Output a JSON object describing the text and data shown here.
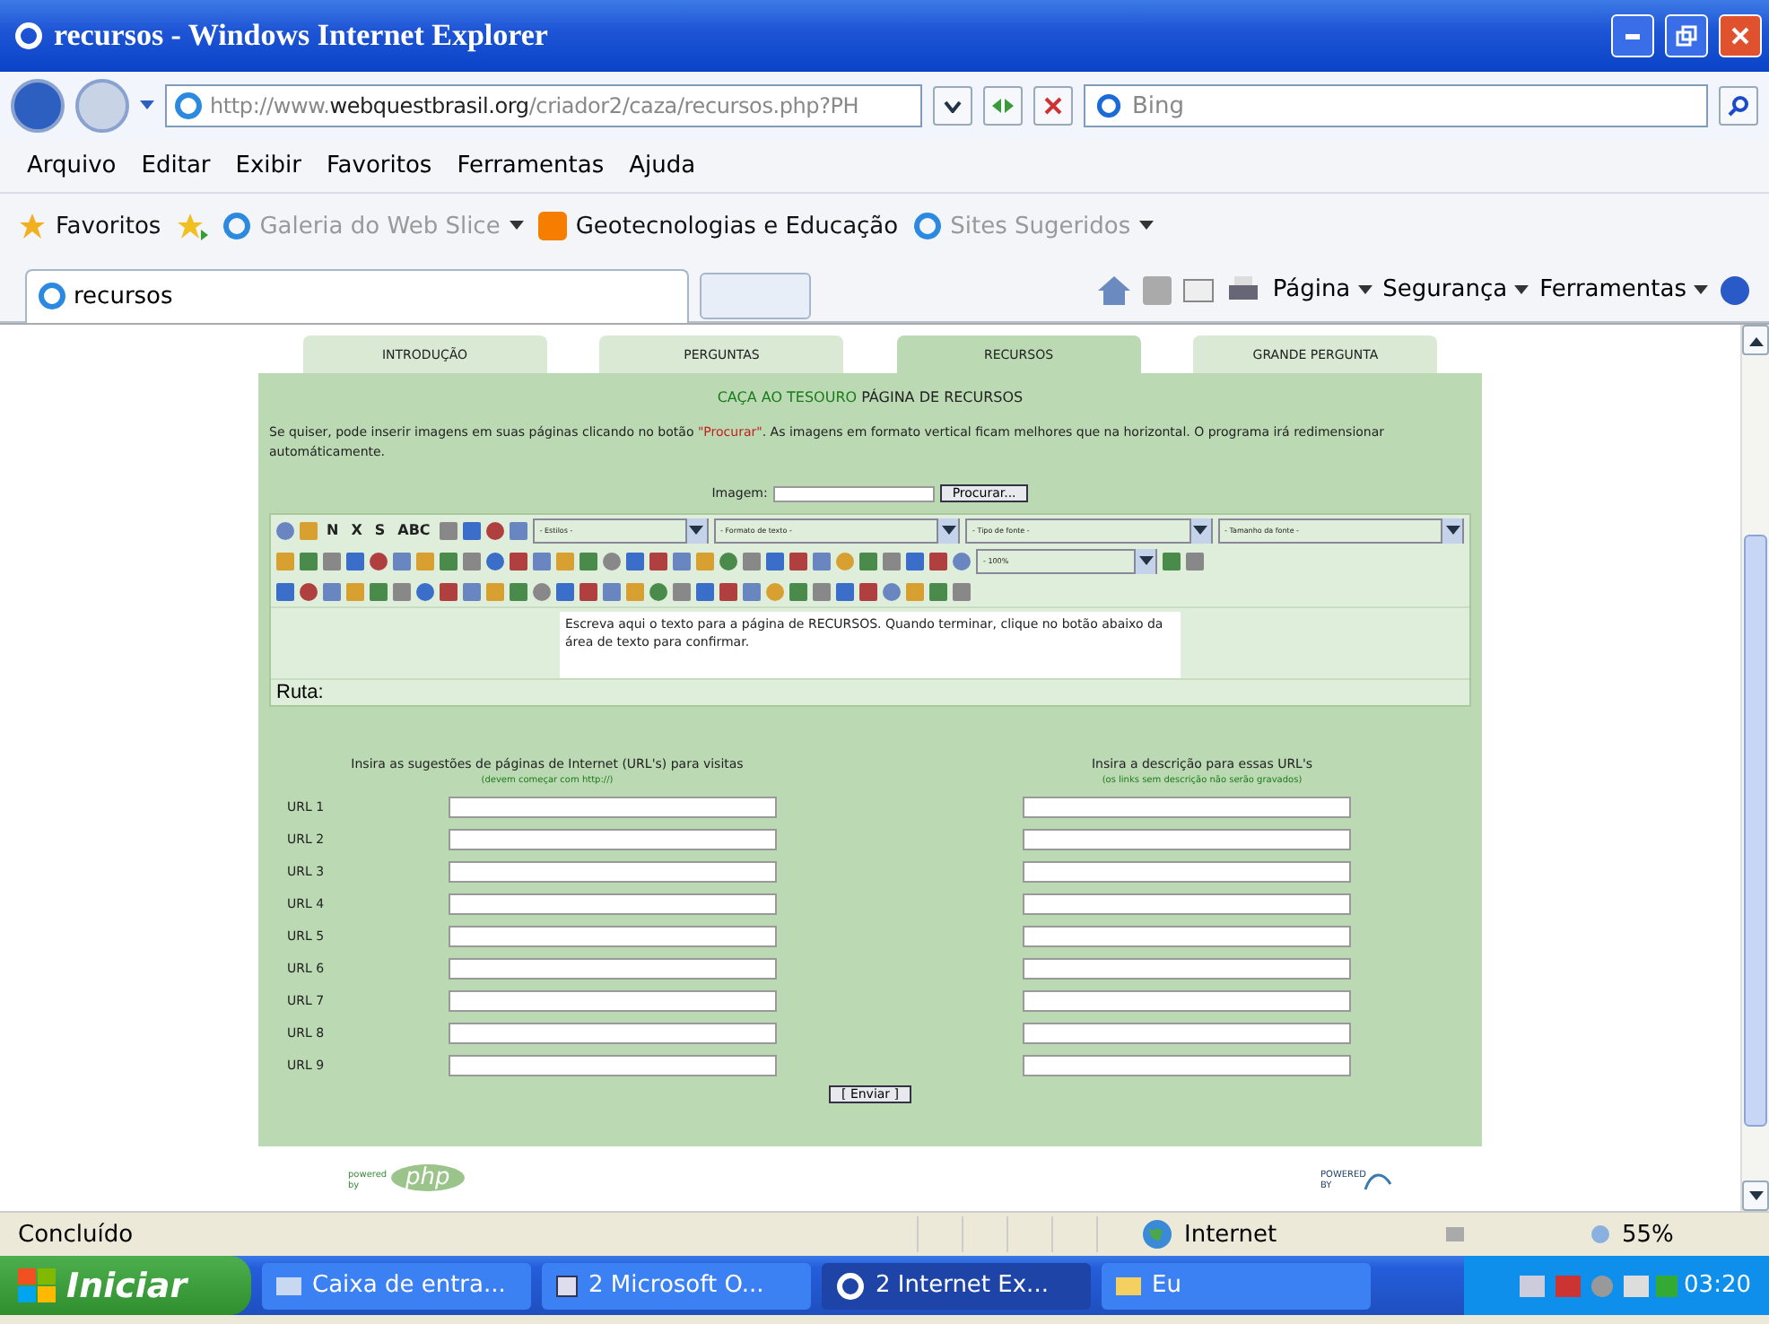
{
  "window": {
    "title": "recursos - Windows Internet Explorer"
  },
  "address_bar": {
    "url_prefix": "http://www.",
    "url_domain": "webquestbrasil.org",
    "url_path": "/criador2/caza/recursos.php?PH",
    "search_placeholder": "Bing"
  },
  "menu": [
    "Arquivo",
    "Editar",
    "Exibir",
    "Favoritos",
    "Ferramentas",
    "Ajuda"
  ],
  "favorites_bar": {
    "favorites": "Favoritos",
    "links": [
      {
        "label": "Galeria do Web Slice",
        "kind": "ie",
        "dimmed": true,
        "dropdown": true
      },
      {
        "label": "Geotecnologias e Educação",
        "kind": "blogger",
        "dimmed": false,
        "dropdown": false
      },
      {
        "label": "Sites Sugeridos",
        "kind": "ie",
        "dimmed": true,
        "dropdown": true
      }
    ]
  },
  "browser_tabs": [
    {
      "label": "recursos",
      "selected": true
    }
  ],
  "command_bar": [
    "Página",
    "Segurança",
    "Ferramentas"
  ],
  "page": {
    "tabs": [
      {
        "label": "INTRODUÇÃO",
        "selected": false
      },
      {
        "label": "PERGUNTAS",
        "selected": false
      },
      {
        "label": "RECURSOS",
        "selected": true
      },
      {
        "label": "GRANDE PERGUNTA",
        "selected": false
      }
    ],
    "heading_prefix": "CAÇA AO TESOURO",
    "heading": "PÁGINA DE RECURSOS",
    "intro": [
      {
        "text": "Se quiser, pode inserir imagens em suas páginas clicando no botão ",
        "highlight": false
      },
      {
        "text": "\"Procurar\"",
        "highlight": true
      },
      {
        "text": ". As imagens em formato vertical ficam melhores que na horizontal. O programa irá redimensionar automáticamente.",
        "highlight": false
      }
    ],
    "image_label": "Imagem:",
    "browse_button": "Procurar...",
    "editor": {
      "text_buttons": [
        "N",
        "X",
        "S",
        "ABC"
      ],
      "selects": [
        "- Estilos -",
        "- Formato de texto -",
        "- Tipo de fonte -",
        "- Tamanho da fonte -"
      ],
      "zoom_select": "- 100%",
      "text": "Escreva aqui o texto para a página de RECURSOS. Quando terminar, clique no botão abaixo da área de texto para confirmar.",
      "path_label": "Ruta:"
    },
    "urls_heading": "Insira as sugestões de páginas de Internet (URL's) para visitas",
    "urls_note": "(devem começar com http://)",
    "desc_heading": "Insira a descrição para essas URL's",
    "desc_note": "(os links sem descrição não serão gravados)",
    "url_rows": [
      "URL 1",
      "URL 2",
      "URL 3",
      "URL 4",
      "URL 5",
      "URL 6",
      "URL 7",
      "URL 8",
      "URL 9"
    ],
    "submit": "[ Enviar ]",
    "footer": {
      "php_caption": "powered by",
      "php": "php",
      "mysql_caption": "POWERED BY"
    }
  },
  "status_bar": {
    "status": "Concluído",
    "zone": "Internet",
    "zoom": "55%"
  },
  "taskbar": {
    "start": "Iniciar",
    "items": [
      {
        "label": "Caixa de entra...",
        "kind": "mail",
        "selected": false
      },
      {
        "label": "2 Microsoft O...",
        "kind": "word",
        "selected": false
      },
      {
        "label": "2 Internet Ex...",
        "kind": "ie",
        "selected": true
      },
      {
        "label": "Eu",
        "kind": "folder",
        "selected": false
      }
    ],
    "clock": "03:20"
  }
}
